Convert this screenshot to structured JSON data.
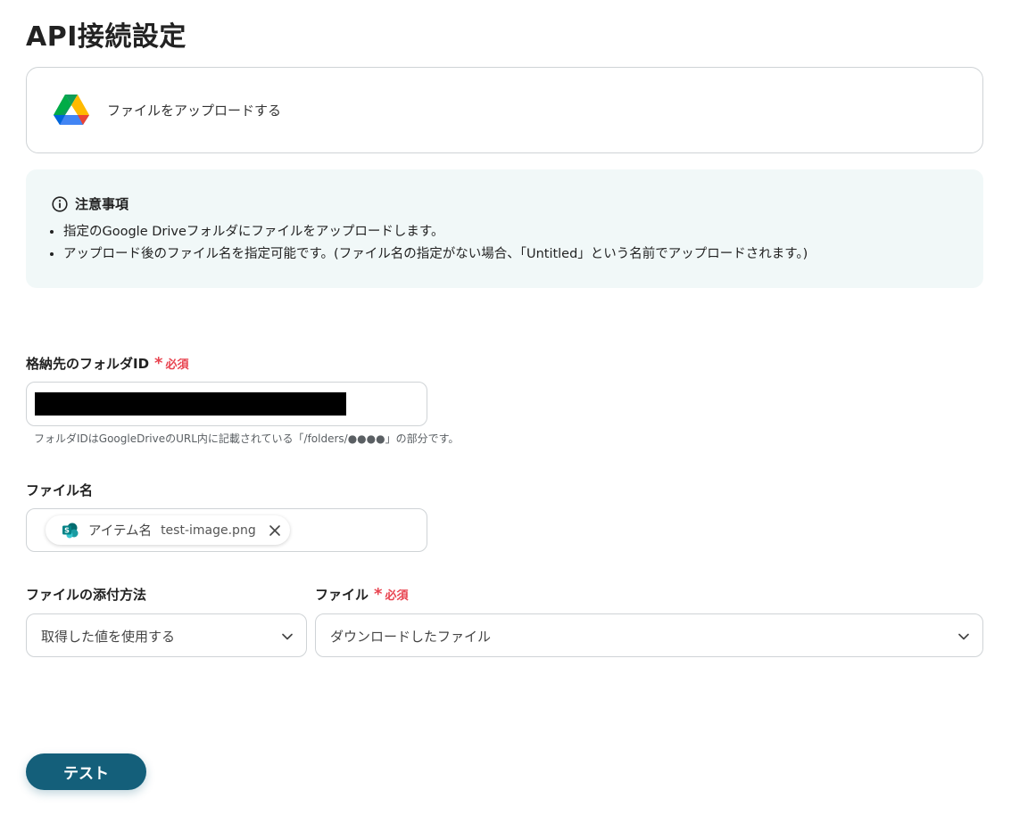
{
  "page": {
    "title": "API接続設定"
  },
  "action": {
    "label": "ファイルをアップロードする"
  },
  "notice": {
    "title": "注意事項",
    "items": [
      "指定のGoogle Driveフォルダにファイルをアップロードします。",
      "アップロード後のファイル名を指定可能です。(ファイル名の指定がない場合、「Untitled」という名前でアップロードされます。)"
    ]
  },
  "folder_id": {
    "label": "格納先のフォルダID",
    "required": "必須",
    "hint": "フォルダIDはGoogleDriveのURL内に記載されている「/folders/●●●●」の部分です。"
  },
  "file_name": {
    "label": "ファイル名",
    "chip_label": "アイテム名",
    "chip_value": "test-image.png"
  },
  "attach_method": {
    "label": "ファイルの添付方法",
    "value": "取得した値を使用する"
  },
  "file": {
    "label": "ファイル",
    "required": "必須",
    "value": "ダウンロードしたファイル"
  },
  "actions": {
    "test_label": "テスト"
  },
  "colors": {
    "primary": "#145f7a",
    "required": "#e8434f",
    "notice_bg": "#f1f8f8"
  },
  "icons": [
    "google-drive-icon",
    "info-icon",
    "sharepoint-icon",
    "close-icon",
    "chevron-down-icon"
  ]
}
